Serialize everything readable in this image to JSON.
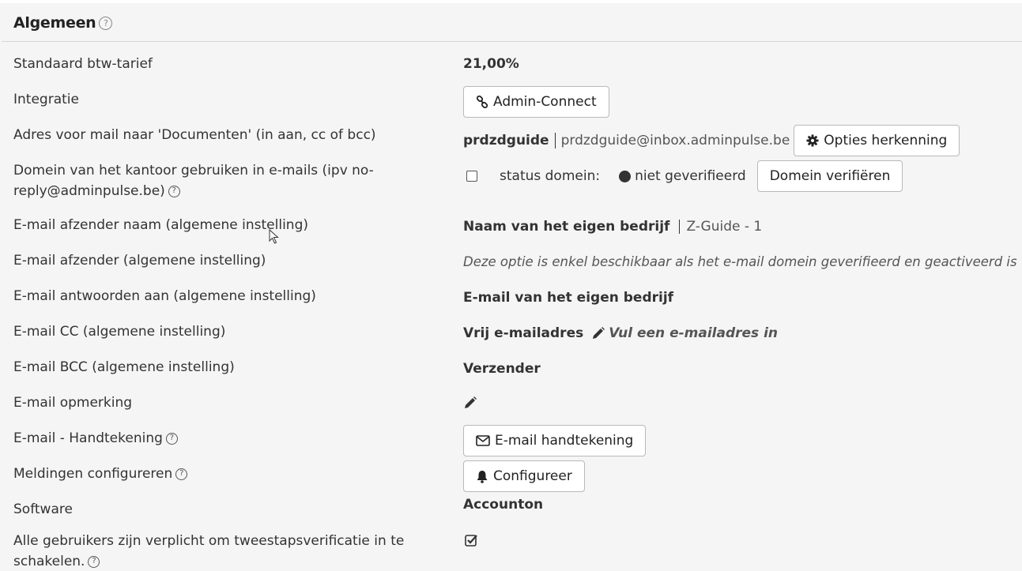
{
  "section": {
    "title": "Algemeen"
  },
  "rows": {
    "btw": {
      "label": "Standaard btw-tarief",
      "value": "21,00%"
    },
    "integratie": {
      "label": "Integratie",
      "button": "Admin-Connect"
    },
    "adres": {
      "label": "Adres voor mail naar 'Documenten' (in aan, cc of bcc)",
      "name": "prdzdguide",
      "email": "prdzdguide@inbox.adminpulse.be",
      "button": "Opties herkenning"
    },
    "domein": {
      "label": "Domein van het kantoor gebruiken in e-mails (ipv no-reply@adminpulse.be)",
      "status_label": "status domein:",
      "status": "niet geverifieerd",
      "button": "Domein verifiëren"
    },
    "afzender_naam": {
      "label": "E-mail afzender naam (algemene instelling)",
      "value": "Naam van het eigen bedrijf",
      "detail": "Z-Guide - 1"
    },
    "afzender": {
      "label": "E-mail afzender (algemene instelling)",
      "value": "Deze optie is enkel beschikbaar als het e-mail domein geverifieerd en geactiveerd is"
    },
    "antwoorden": {
      "label": "E-mail antwoorden aan (algemene instelling)",
      "value": "E-mail van het eigen bedrijf"
    },
    "cc": {
      "label": "E-mail CC (algemene instelling)",
      "value": "Vrij e-mailadres",
      "link": "Vul een e-mailadres in"
    },
    "bcc": {
      "label": "E-mail BCC (algemene instelling)",
      "value": "Verzender"
    },
    "opmerking": {
      "label": "E-mail opmerking"
    },
    "handtekening": {
      "label": "E-mail - Handtekening",
      "button": "E-mail handtekening"
    },
    "meldingen": {
      "label": "Meldingen configureren",
      "button": "Configureer"
    },
    "software": {
      "label": "Software",
      "value": "Accounton"
    },
    "tweestaps": {
      "label": "Alle gebruikers zijn verplicht om tweestapsverificatie in te schakelen.",
      "checked": true
    }
  },
  "icons": {
    "help": "question-circle-icon",
    "link": "link-icon",
    "gear": "gear-icon",
    "pencil": "pencil-icon",
    "envelope": "envelope-icon",
    "bell": "bell-icon",
    "check": "checkbox-checked-icon",
    "cursor": "mouse-pointer-icon"
  }
}
